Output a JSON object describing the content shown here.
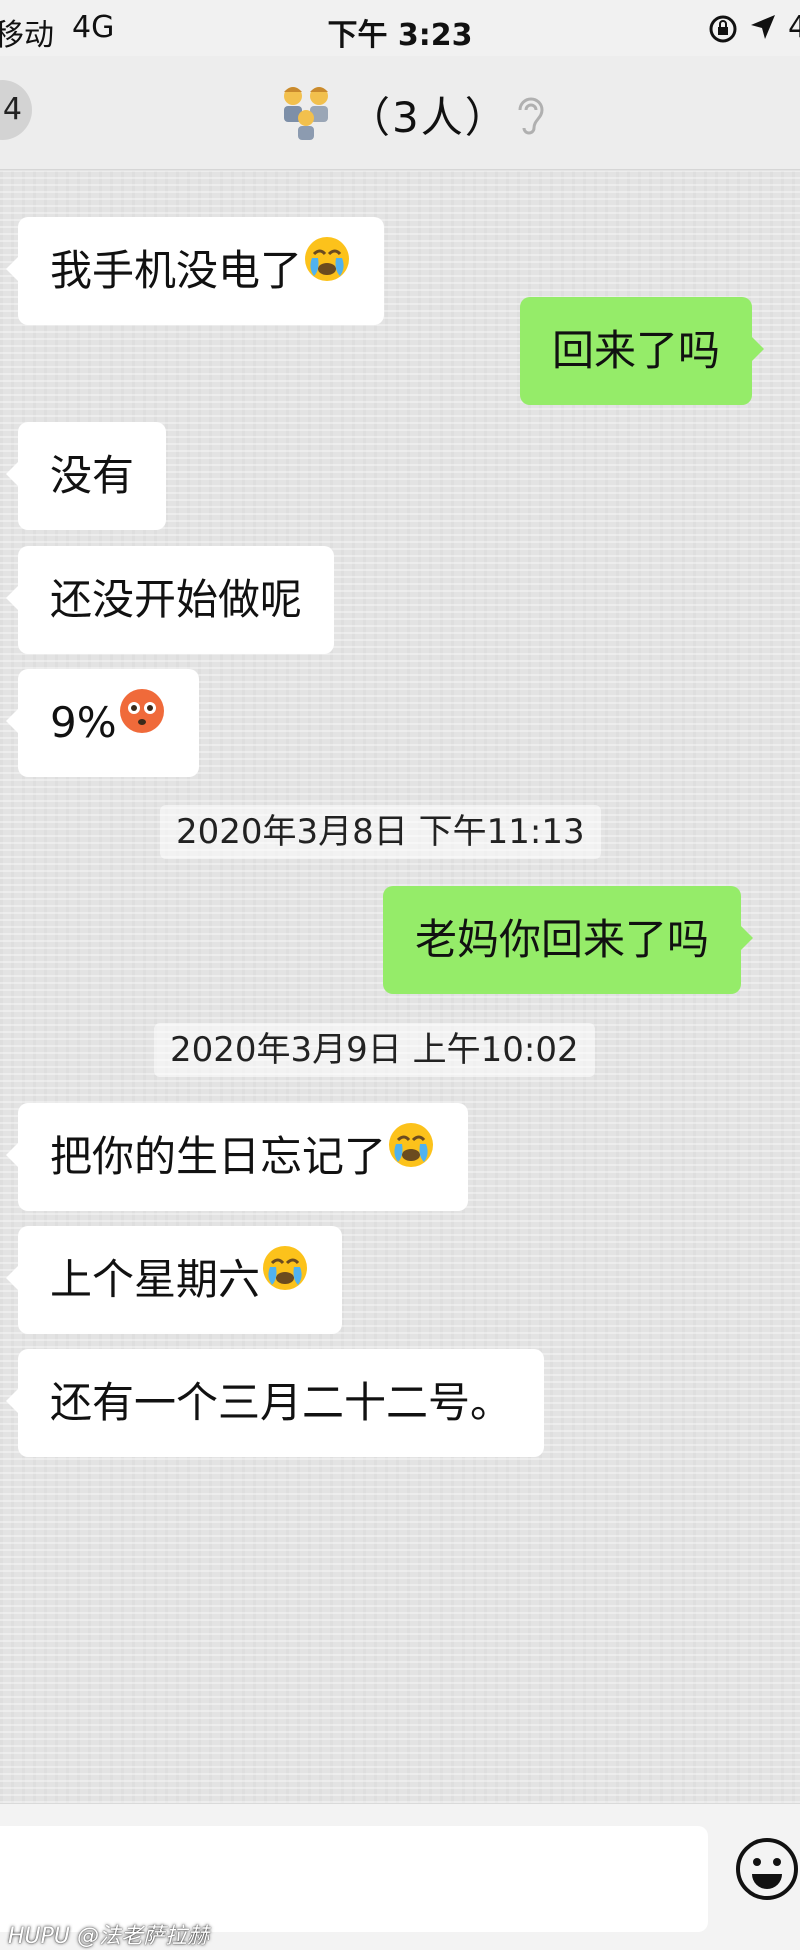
{
  "status_bar": {
    "carrier": "移动",
    "network": "4G",
    "time": "下午 3:23",
    "battery": "4"
  },
  "nav": {
    "back_badge": "4",
    "title": "（3人）",
    "group_icon": "family-icon",
    "ear_icon": "ear-icon"
  },
  "messages": [
    {
      "side": "in",
      "text": "我手机没电了",
      "emoji": "crying-face"
    },
    {
      "side": "out",
      "text": "回来了吗"
    },
    {
      "side": "in",
      "text": "没有"
    },
    {
      "side": "in",
      "text": "还没开始做呢"
    },
    {
      "side": "in",
      "text": "9%",
      "emoji": "flushed-face"
    },
    {
      "side": "out",
      "text": "老妈你回来了吗"
    },
    {
      "side": "in",
      "text": "把你的生日忘记了",
      "emoji": "crying-face"
    },
    {
      "side": "in",
      "text": "上个星期六",
      "emoji": "crying-face"
    },
    {
      "side": "in",
      "text": "还有一个三月二十二号。"
    }
  ],
  "timestamps": [
    "2020年3月8日 下午11:13",
    "2020年3月9日 上午10:02"
  ],
  "input_bar": {
    "emoji_button_icon": "smiley-icon",
    "watermark": "HUPU @法老萨拉赫"
  },
  "colors": {
    "outgoing_bubble": "#95ec69",
    "incoming_bubble": "#ffffff",
    "chat_background": "#e3e3e3"
  }
}
